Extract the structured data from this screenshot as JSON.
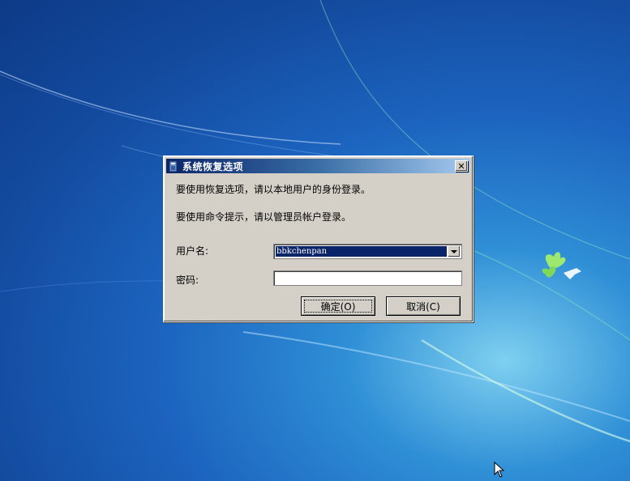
{
  "dialog": {
    "title": "系统恢复选项",
    "close_symbol": "✕",
    "message1": "要使用恢复选项，请以本地用户的身份登录。",
    "message2": "要使用命令提示，请以管理员帐户登录。",
    "username_label": "用户名:",
    "username_value": "bbkchenpan",
    "password_label": "密码:",
    "password_value": "",
    "ok_label": "确定(O)",
    "cancel_label": "取消(C)"
  },
  "icons": {
    "title": "system-recovery-icon",
    "close": "close-icon",
    "dropdown": "chevron-down-icon",
    "cursor": "mouse-cursor-icon",
    "wallpaper_logo": "windows-bird-logo-icon"
  },
  "colors": {
    "desktop_dark": "#0d3a87",
    "desktop_light": "#7fd0f0",
    "dialog_face": "#d4d0c8",
    "titlebar_start": "#0a246a",
    "titlebar_end": "#a6caf0",
    "selection": "#0a246a"
  }
}
